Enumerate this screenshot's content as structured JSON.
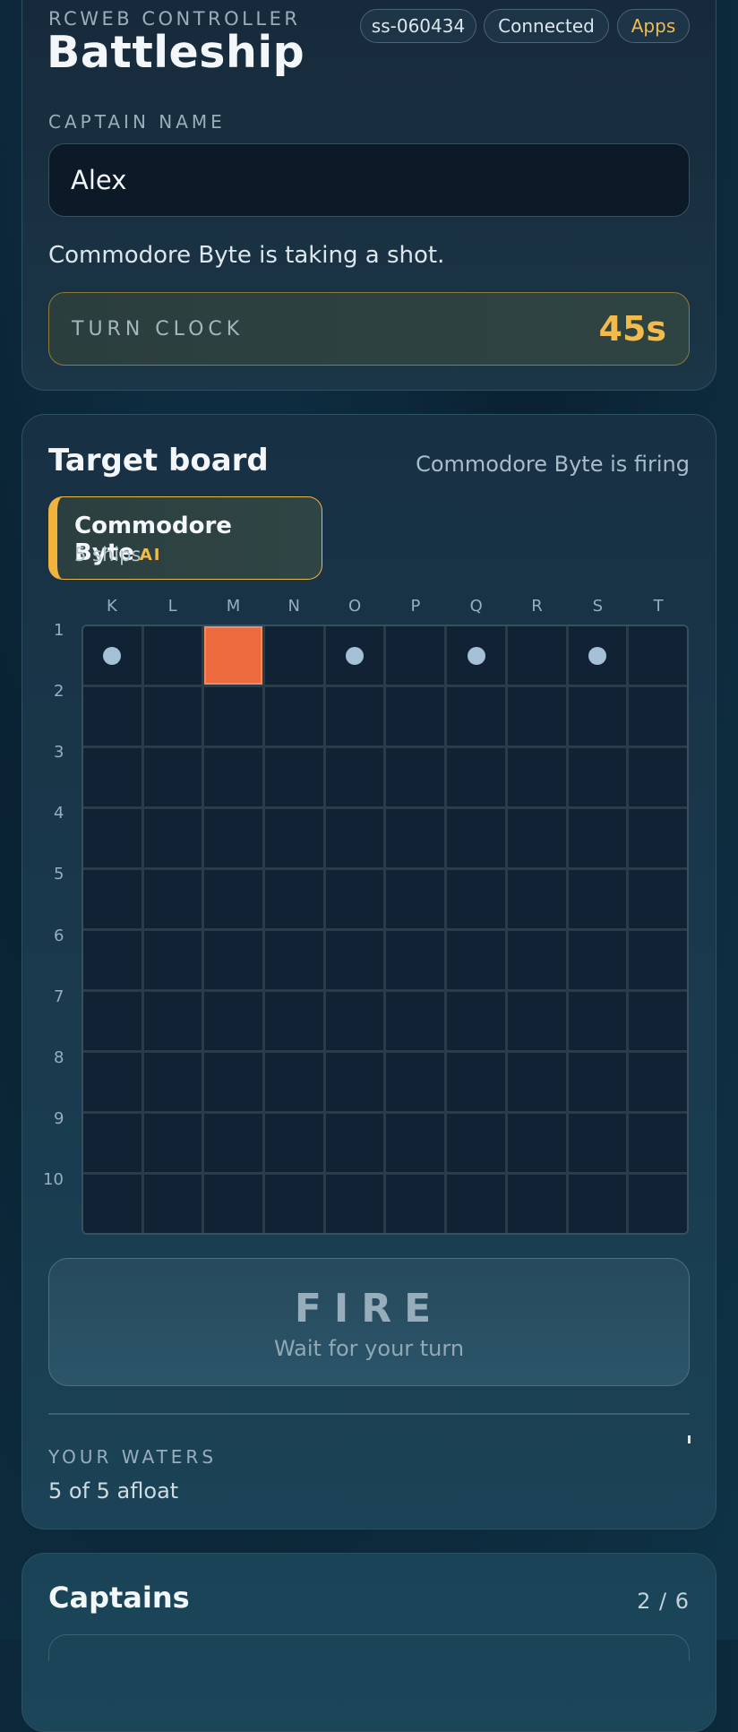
{
  "header": {
    "eyebrow": "RCWEB CONTROLLER",
    "title": "Battleship",
    "session_id": "ss-060434",
    "connection_status": "Connected",
    "apps_label": "Apps",
    "apps_color": "#f2bb4b"
  },
  "captain": {
    "label": "CAPTAIN NAME",
    "value": "Alex",
    "placeholder": ""
  },
  "status_message": "Commodore Byte is taking a shot.",
  "turn_clock": {
    "label": "TURN CLOCK",
    "value": "45s"
  },
  "board": {
    "title": "Target board",
    "status": "Commodore Byte is firing",
    "opponent": {
      "name": "Commodore Byte",
      "badge": "AI",
      "ships": "5 ships"
    },
    "columns": [
      "K",
      "L",
      "M",
      "N",
      "O",
      "P",
      "Q",
      "R",
      "S",
      "T"
    ],
    "rows": [
      "1",
      "2",
      "3",
      "4",
      "5",
      "6",
      "7",
      "8",
      "9",
      "10"
    ],
    "cells": [
      [
        "miss",
        "empty",
        "hit",
        "empty",
        "miss",
        "empty",
        "miss",
        "empty",
        "miss",
        "empty"
      ],
      [
        "empty",
        "empty",
        "empty",
        "empty",
        "empty",
        "empty",
        "empty",
        "empty",
        "empty",
        "empty"
      ],
      [
        "empty",
        "empty",
        "empty",
        "empty",
        "empty",
        "empty",
        "empty",
        "empty",
        "empty",
        "empty"
      ],
      [
        "empty",
        "empty",
        "empty",
        "empty",
        "empty",
        "empty",
        "empty",
        "empty",
        "empty",
        "empty"
      ],
      [
        "empty",
        "empty",
        "empty",
        "empty",
        "empty",
        "empty",
        "empty",
        "empty",
        "empty",
        "empty"
      ],
      [
        "empty",
        "empty",
        "empty",
        "empty",
        "empty",
        "empty",
        "empty",
        "empty",
        "empty",
        "empty"
      ],
      [
        "empty",
        "empty",
        "empty",
        "empty",
        "empty",
        "empty",
        "empty",
        "empty",
        "empty",
        "empty"
      ],
      [
        "empty",
        "empty",
        "empty",
        "empty",
        "empty",
        "empty",
        "empty",
        "empty",
        "empty",
        "empty"
      ],
      [
        "empty",
        "empty",
        "empty",
        "empty",
        "empty",
        "empty",
        "empty",
        "empty",
        "empty",
        "empty"
      ],
      [
        "empty",
        "empty",
        "empty",
        "empty",
        "empty",
        "empty",
        "empty",
        "empty",
        "empty",
        "empty"
      ]
    ],
    "hit_color": "#ec6a3e",
    "miss_color": "#a4c1d8"
  },
  "fire_button": {
    "label": "FIRE",
    "sublabel": "Wait for your turn"
  },
  "waters": {
    "label": "YOUR WATERS",
    "value": "5 of 5 afloat"
  },
  "captains": {
    "title": "Captains",
    "count": "2 / 6"
  }
}
